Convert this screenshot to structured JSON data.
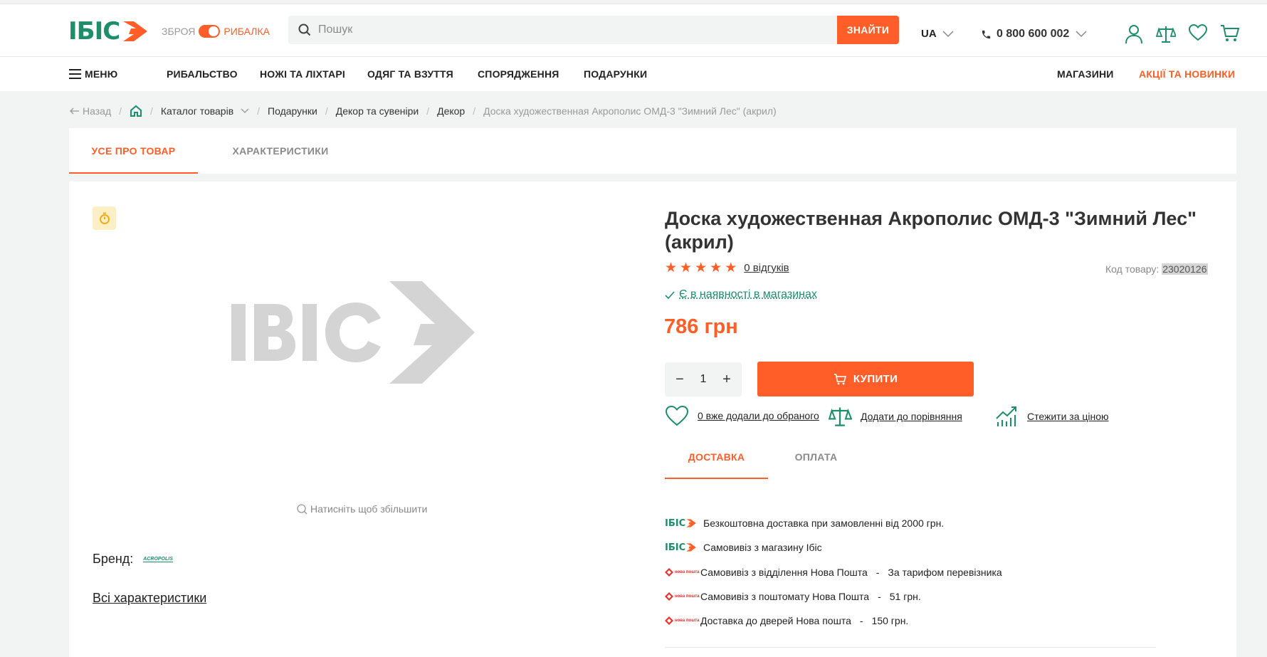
{
  "header": {
    "logo_text": "ІБІС",
    "mode_left": "ЗБРОЯ",
    "mode_right": "РИБАЛКА",
    "search_placeholder": "Пошук",
    "search_button": "ЗНАЙТИ",
    "lang": "UA",
    "phone": "0 800 600 002",
    "icons": [
      "user-icon",
      "compare-scales-icon",
      "heart-icon",
      "cart-icon"
    ]
  },
  "nav": {
    "menu": "МЕНЮ",
    "items": [
      "РИБАЛЬСТВО",
      "НОЖІ ТА ЛІХТАРІ",
      "ОДЯГ ТА ВЗУТТЯ",
      "СПОРЯДЖЕННЯ",
      "ПОДАРУНКИ"
    ],
    "stores": "МАГАЗИНИ",
    "promo": "АКЦІЇ ТА НОВИНКИ"
  },
  "breadcrumbs": {
    "back": "Назад",
    "catalog": "Каталог товарів",
    "items": [
      "Подарунки",
      "Декор та сувеніри",
      "Декор"
    ],
    "current": "Доска художественная Акрополис ОМД-3 \"Зимний Лес\" (акрил)"
  },
  "tabs": {
    "about": "УСЕ ПРО ТОВАР",
    "specs": "ХАРАКТЕРИСТИКИ"
  },
  "gallery": {
    "zoom_hint": "Натисніть щоб збільшити"
  },
  "product": {
    "title": "Доска художественная Акрополис ОМД-3 \"Зимний Лес\" (акрил)",
    "rating": 5,
    "reviews": "0 відгуків",
    "code_label": "Код товару:",
    "code": "23020126",
    "stock": "Є в наявності в магазинах",
    "price": "786 грн",
    "qty": "1",
    "buy": "КУПИТИ",
    "fav": "0 вже додали до обраного",
    "compare": "Додати до порівняння",
    "track": "Стежити за ціною",
    "brand_label": "Бренд:",
    "brand_logo_text": "ACROPOLIS",
    "all_chars": "Всі характеристики"
  },
  "delivery": {
    "tab_delivery": "ДОСТАВКА",
    "tab_payment": "ОПЛАТА",
    "rows": [
      {
        "provider": "ibis",
        "text": "Безкоштовна доставка при замовленні від 2000 грн.",
        "dash": "",
        "price": ""
      },
      {
        "provider": "ibis",
        "text": "Самовивіз з магазину Ібіс",
        "dash": "",
        "price": ""
      },
      {
        "provider": "np",
        "text": "Самовивіз з відділення Нова Пошта",
        "dash": "-",
        "price": "За тарифом перевізника"
      },
      {
        "provider": "np",
        "text": "Самовивіз з поштомату Нова Пошта",
        "dash": "-",
        "price": "51 грн."
      },
      {
        "provider": "np",
        "text": "Доставка до дверей Нова пошта",
        "dash": "-",
        "price": "150 грн."
      }
    ],
    "np_logo": "нова пошта"
  },
  "colors": {
    "accent": "#ff5e28",
    "brand": "#1e8d6a"
  }
}
